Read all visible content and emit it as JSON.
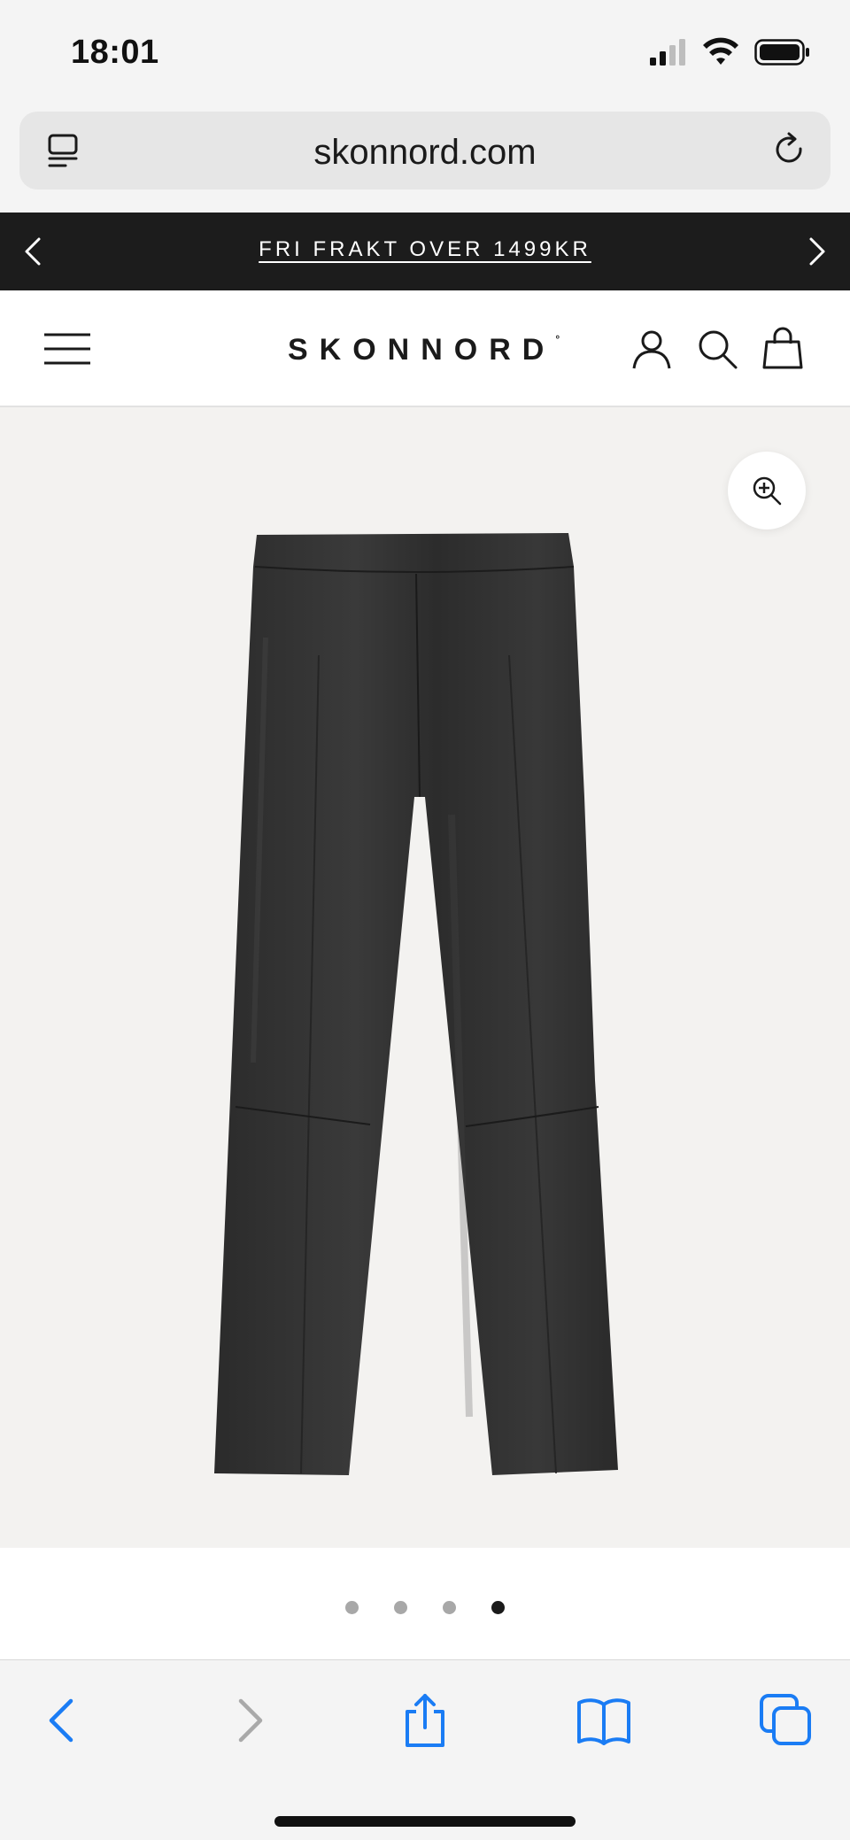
{
  "status": {
    "time": "18:01"
  },
  "browser": {
    "url": "skonnord.com"
  },
  "promo": {
    "text": "FRI FRAKT OVER 1499KR"
  },
  "header": {
    "logo": "SKONNORD"
  },
  "gallery": {
    "image_alt": "Black leather cropped pants",
    "slide_count": 4,
    "active_slide": 4
  },
  "colors": {
    "promo_bg": "#1c1c1c",
    "safari_blue": "#1a7cf4",
    "dot_active": "#1a1a1a",
    "dot_inactive": "#a8a8a8"
  }
}
